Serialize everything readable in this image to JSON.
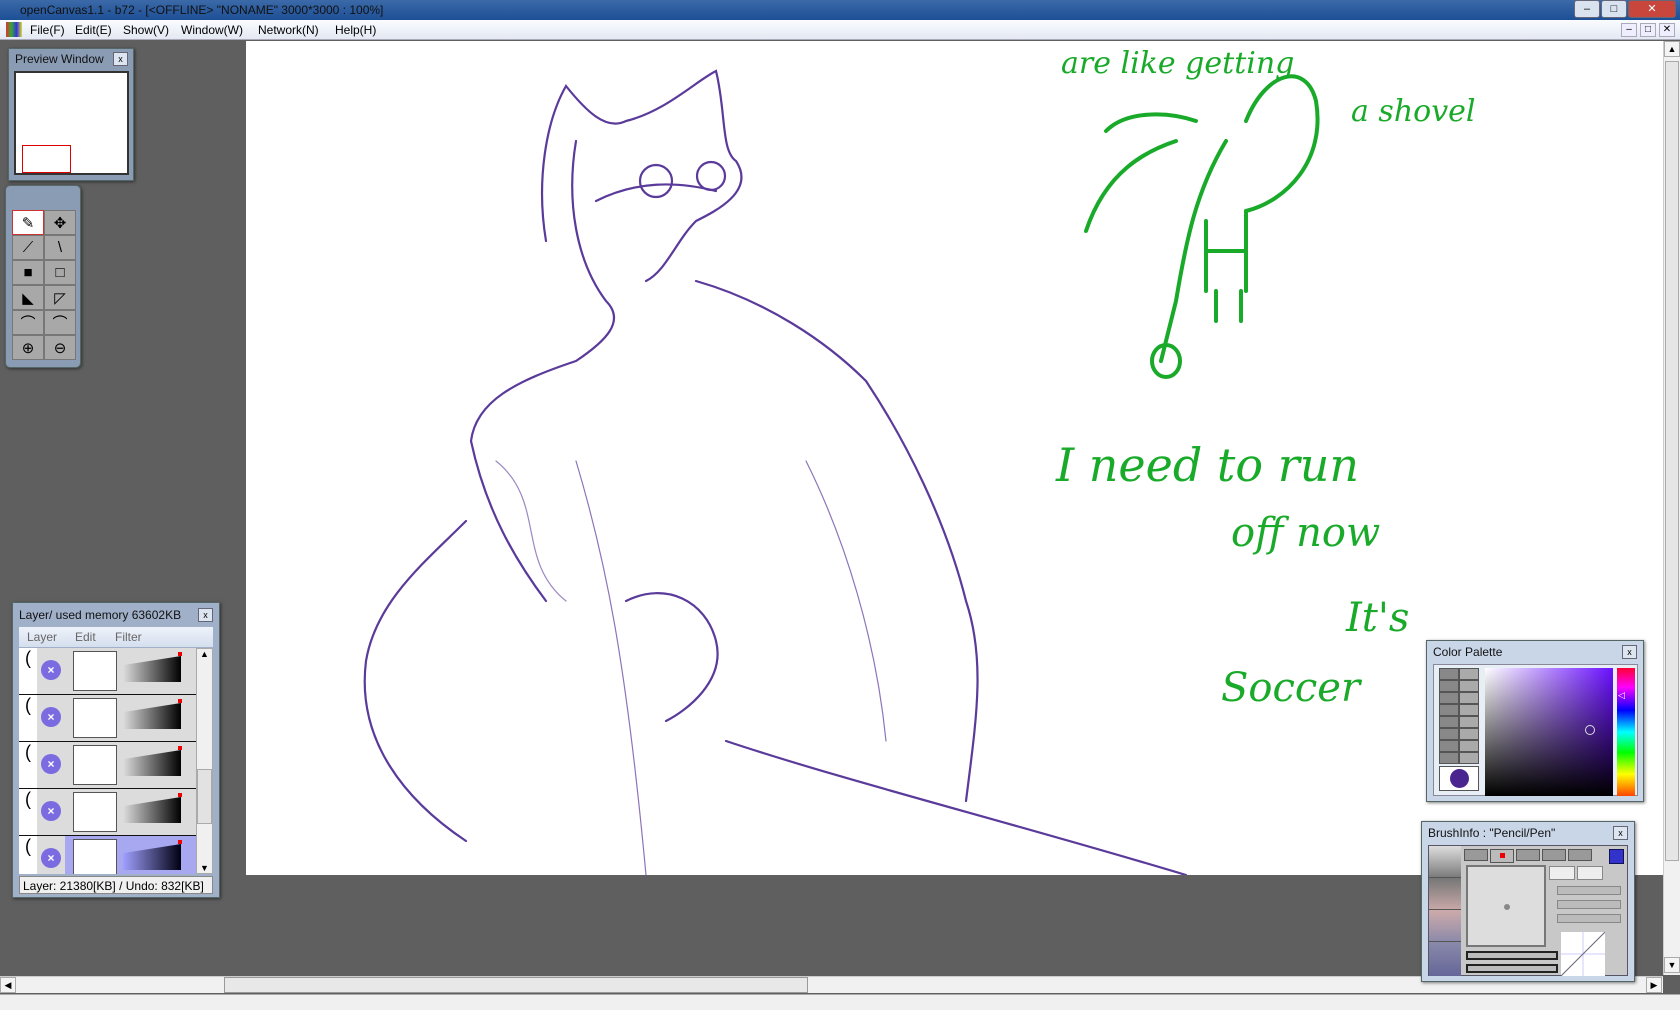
{
  "window": {
    "title": "openCanvas1.1 - b72 - [<OFFLINE>  \"NONAME\" 3000*3000 : 100%]",
    "minimize": "–",
    "maximize": "□",
    "close": "✕"
  },
  "menu": {
    "items": [
      "File(F)",
      "Edit(E)",
      "Show(V)",
      "Window(W)",
      "Network(N)",
      "Help(H)"
    ]
  },
  "preview": {
    "title": "Preview Window",
    "close": "x"
  },
  "toolbox": {
    "tools": [
      {
        "name": "pencil-pen",
        "glyph": "✎"
      },
      {
        "name": "move",
        "glyph": "✥"
      },
      {
        "name": "eyedropper",
        "glyph": "⟋"
      },
      {
        "name": "line",
        "glyph": "\\"
      },
      {
        "name": "rect-select-add",
        "glyph": "■"
      },
      {
        "name": "rect-select-sub",
        "glyph": "□"
      },
      {
        "name": "lasso-add",
        "glyph": "◣"
      },
      {
        "name": "lasso-sub",
        "glyph": "◸"
      },
      {
        "name": "curve-a",
        "glyph": "⌒"
      },
      {
        "name": "curve-b",
        "glyph": "⌒"
      },
      {
        "name": "zoom-in",
        "glyph": "⊕"
      },
      {
        "name": "zoom-out",
        "glyph": "⊖"
      }
    ]
  },
  "layers": {
    "title": "Layer/ used memory 63602KB",
    "close": "x",
    "menu": [
      "Layer",
      "Edit",
      "Filter"
    ],
    "status": "Layer: 21380[KB] / Undo: 832[KB]",
    "count": 5,
    "selected_index": 4
  },
  "color_palette": {
    "title": "Color Palette",
    "close": "x",
    "current_color": "#4a2590",
    "hue_color": "#6a10ff"
  },
  "brush_info": {
    "title": "BrushInfo : \"Pencil/Pen\"",
    "close": "x"
  },
  "canvas": {
    "handwriting": [
      "are like getting",
      "a shovel",
      "I need to run",
      "off now",
      "It's",
      "Soccer"
    ],
    "ink_purple": "#5a3a9a",
    "ink_green": "#1aaa2a"
  }
}
